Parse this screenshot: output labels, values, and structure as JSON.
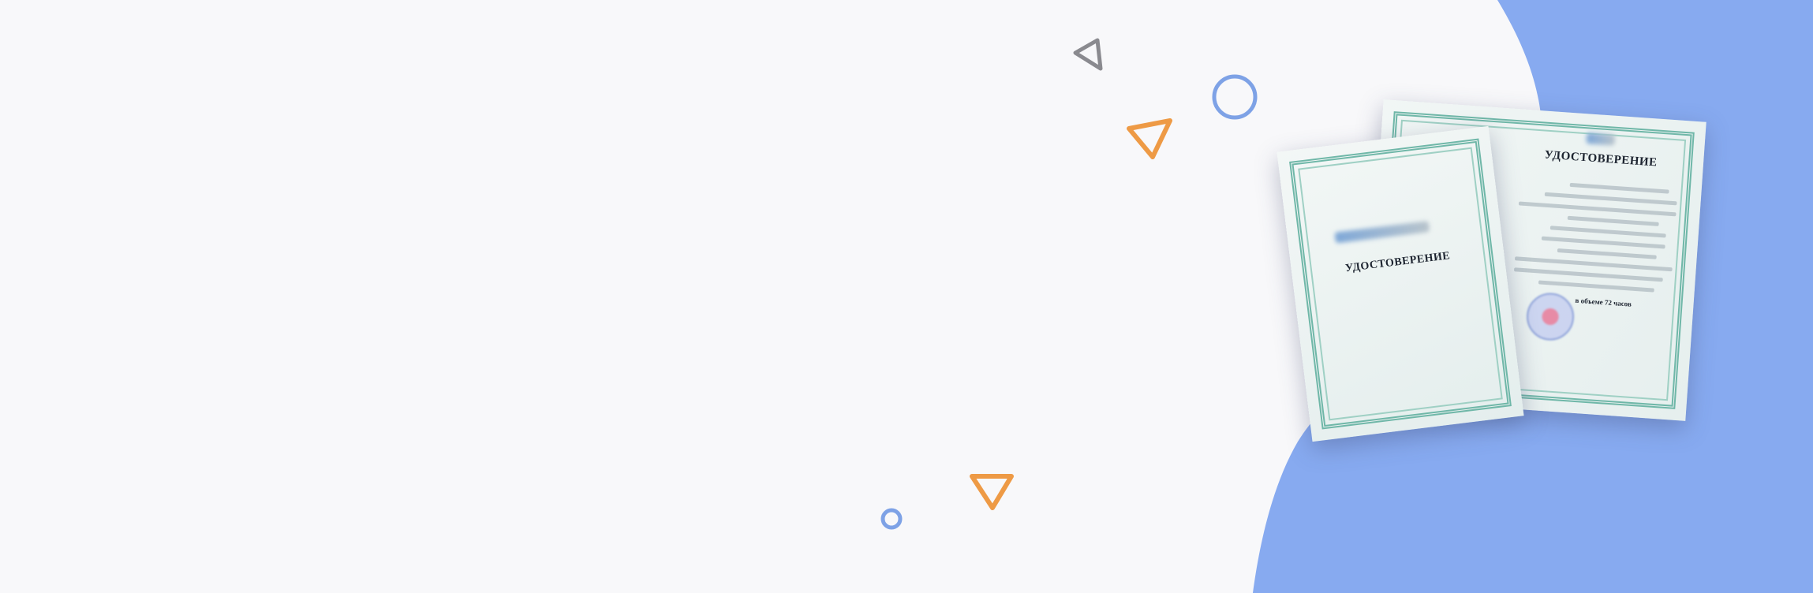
{
  "colors": {
    "background": "#f8f8fa",
    "blob": "#87aaf0",
    "orange": "#ee9a45",
    "gray": "#8a8a8f",
    "blue_outline": "#7ea2e6"
  },
  "certificate": {
    "front_title": "УДОСТОВЕРЕНИЕ",
    "back_title": "УДОСТОВЕРЕНИЕ",
    "hours_text": "в объеме 72 часов"
  },
  "decorations": [
    "gray-triangle",
    "orange-triangle-top",
    "blue-ring-large",
    "orange-triangle-bottom",
    "blue-ring-small"
  ]
}
